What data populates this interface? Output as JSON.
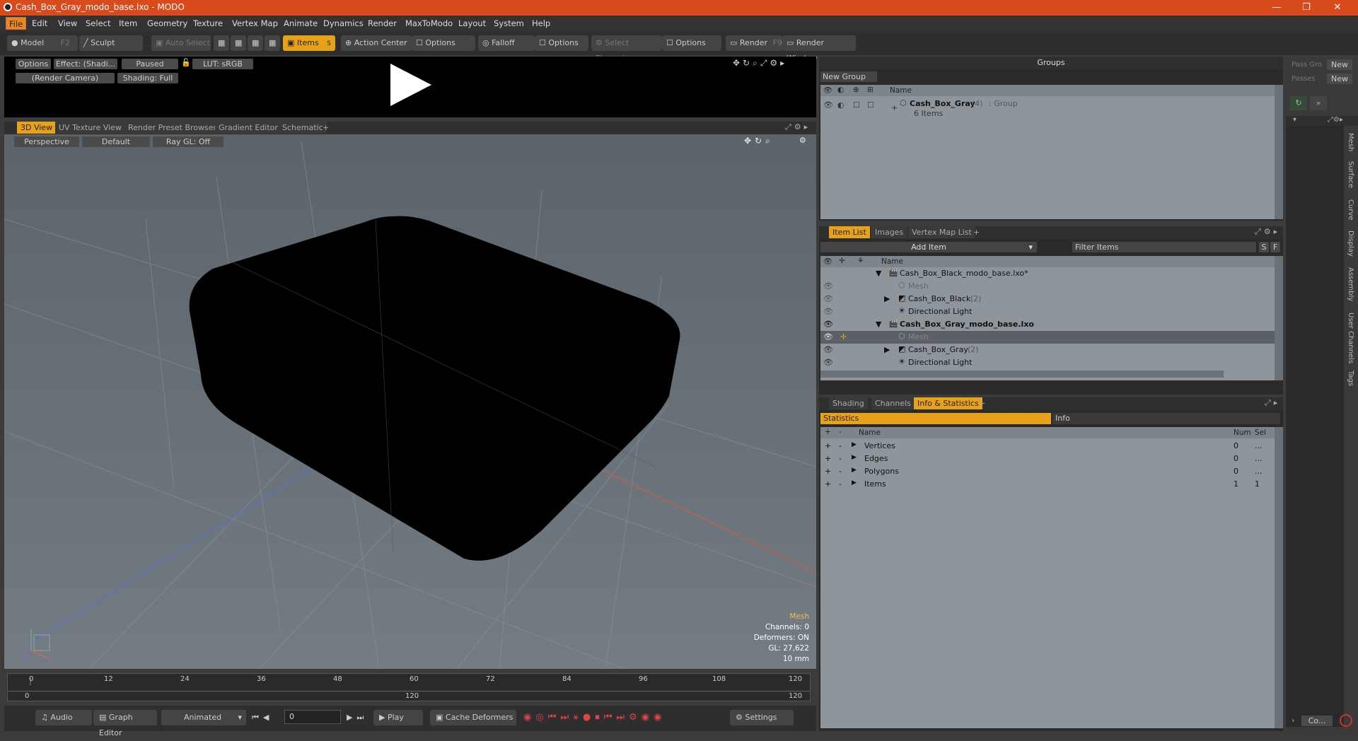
{
  "window": {
    "title": "Cash_Box_Gray_modo_base.lxo - MODO",
    "controls": [
      "—",
      "❐",
      "✕"
    ]
  },
  "menu": [
    "File",
    "Edit",
    "View",
    "Select",
    "Item",
    "Geometry",
    "Texture",
    "Vertex Map",
    "Animate",
    "Dynamics",
    "Render",
    "MaxToModo",
    "Layout",
    "System",
    "Help"
  ],
  "toolbar": {
    "model": "Model",
    "model_key": "F2",
    "sculpt": "Sculpt",
    "auto_select": "Auto Select",
    "items": "Items",
    "items_key": "S",
    "action_center": "Action Center",
    "options1": "Options",
    "falloff": "Falloff",
    "options2": "Options",
    "select_through": "Select Through",
    "options3": "Options",
    "render": "Render",
    "render_key": "F9",
    "render_window": "Render Window"
  },
  "preview": {
    "options": "Options",
    "effect": "Effect: (Shadi...",
    "paused": "Paused",
    "lut": "LUT: sRGB",
    "camera": "(Render Camera)",
    "shading": "Shading: Full"
  },
  "view_tabs": [
    "3D View",
    "UV Texture View",
    "Render Preset Browser",
    "Gradient Editor",
    "Schematic",
    "+"
  ],
  "viewport": {
    "perspective": "Perspective",
    "default": "Default",
    "raygl": "Ray GL: Off",
    "info_title": "Mesh",
    "channels": "Channels: 0",
    "deformers": "Deformers: ON",
    "gl": "GL: 27,622",
    "units": "10 mm"
  },
  "groups": {
    "title": "Groups",
    "new_group": "New Group",
    "name_header": "Name",
    "item_name": "Cash_Box_Gray",
    "item_count": "(4)",
    "item_type": ": Group",
    "item_sub": "6 Items"
  },
  "pass": {
    "pass_groups": "Pass Gro",
    "passes": "Passes",
    "new1": "New",
    "new2": "New"
  },
  "item_tabs": [
    "Item List",
    "Images",
    "Vertex Map List",
    "+"
  ],
  "item_list": {
    "add_item": "Add Item",
    "filter": "Filter Items",
    "s": "S",
    "f": "F",
    "name_header": "Name",
    "rows": [
      {
        "label": "Cash_Box_Black_modo_base.lxo*",
        "type": "scene"
      },
      {
        "label": "Mesh",
        "type": "mesh"
      },
      {
        "label": "Cash_Box_Black",
        "count": "(2)",
        "type": "group"
      },
      {
        "label": "Directional Light",
        "type": "light"
      },
      {
        "label": "Cash_Box_Gray_modo_base.lxo",
        "type": "scene-bold"
      },
      {
        "label": "Mesh",
        "type": "mesh-sel"
      },
      {
        "label": "Cash_Box_Gray",
        "count": "(2)",
        "type": "group"
      },
      {
        "label": "Directional Light",
        "type": "light"
      }
    ]
  },
  "info_tabs": [
    "Shading",
    "Channels",
    "Info & Statistics",
    "+"
  ],
  "stats": {
    "statistics": "Statistics",
    "info": "Info",
    "name": "Name",
    "num": "Num",
    "sel": "Sel",
    "rows": [
      {
        "name": "Vertices",
        "num": "0",
        "sel": "..."
      },
      {
        "name": "Edges",
        "num": "0",
        "sel": "..."
      },
      {
        "name": "Polygons",
        "num": "0",
        "sel": "..."
      },
      {
        "name": "Items",
        "num": "1",
        "sel": "1"
      }
    ]
  },
  "side_tabs": [
    "Mesh",
    "Surface",
    "Curve",
    "Display",
    "Assembly",
    "User Channels",
    "Tags"
  ],
  "timeline": {
    "ticks": [
      "0",
      "12",
      "24",
      "36",
      "48",
      "60",
      "72",
      "84",
      "96",
      "108",
      "120"
    ],
    "low": [
      "0",
      "120",
      "120"
    ]
  },
  "bottom": {
    "audio": "Audio",
    "graph_editor": "Graph Editor",
    "animated": "Animated",
    "frame": "0",
    "play": "Play",
    "cache": "Cache Deformers",
    "settings": "Settings",
    "co": "Co..."
  }
}
